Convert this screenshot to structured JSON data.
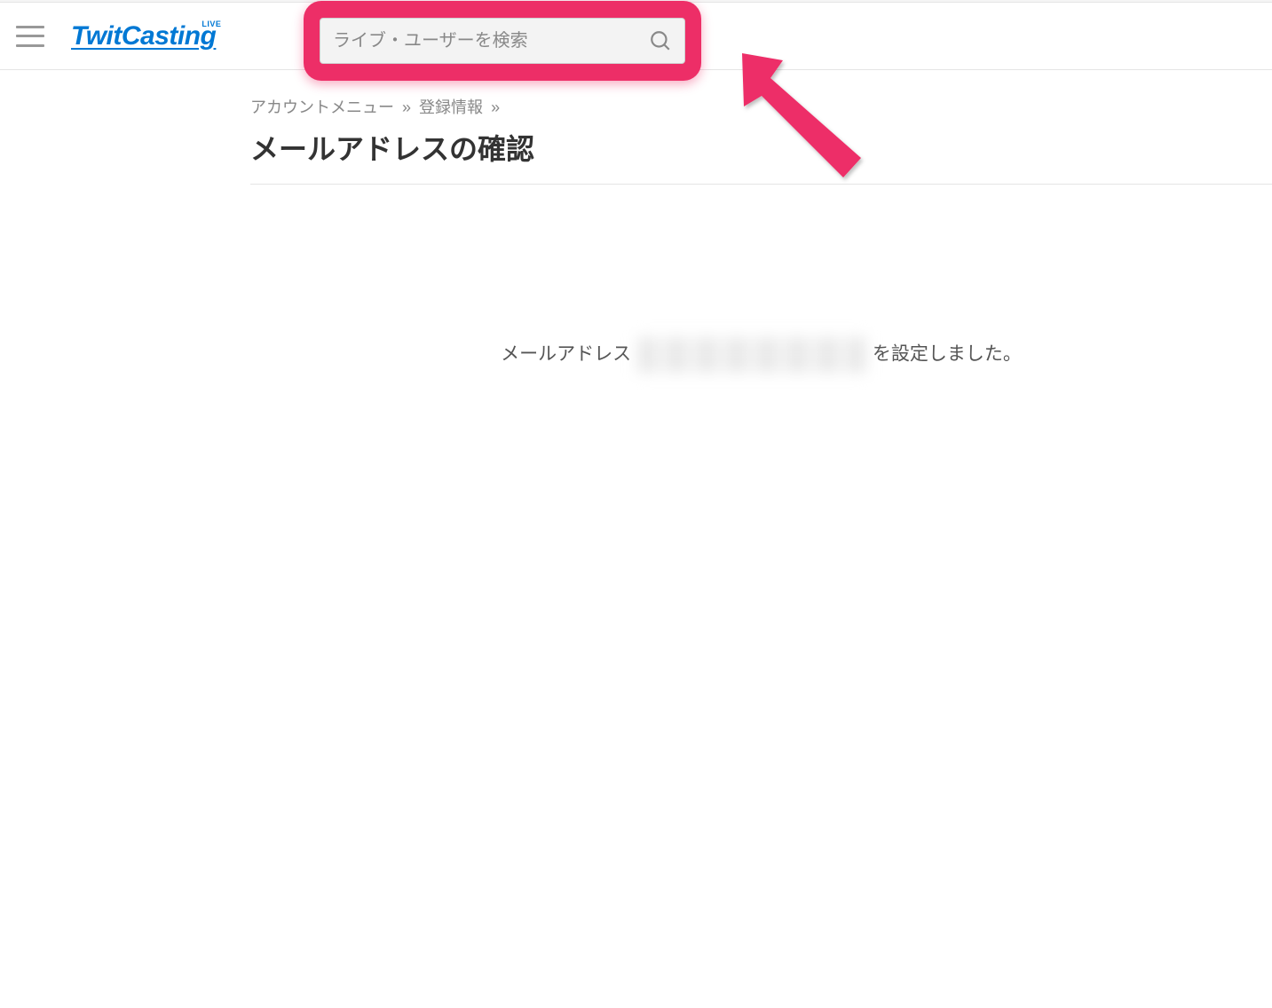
{
  "header": {
    "logo_text": "TwitCasting",
    "logo_badge": "LIVE",
    "search_placeholder": "ライブ・ユーザーを検索"
  },
  "breadcrumb": {
    "item1": "アカウントメニュー",
    "item2": "登録情報",
    "sep": "»"
  },
  "page": {
    "title": "メールアドレスの確認"
  },
  "message": {
    "prefix": "メールアドレス ",
    "suffix": " を設定しました。"
  },
  "annotation": {
    "highlight_color": "#ed2e67"
  }
}
